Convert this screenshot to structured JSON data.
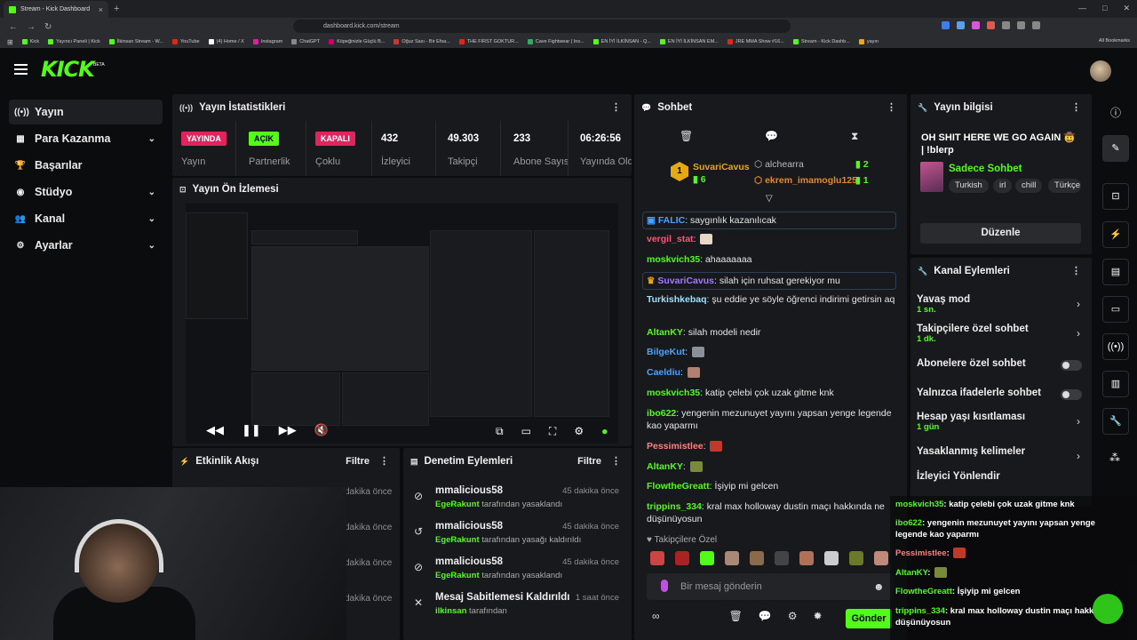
{
  "browser": {
    "tab_title": "Stream - Kick Dashboard",
    "url": "dashboard.kick.com/stream",
    "bookmarks": [
      "Kick",
      "Yayıncı Paneli | Kick",
      "İlkinsan Stream - W...",
      "YouTube",
      "(4) Home / X",
      "Instagram",
      "ChatGPT",
      "Köpeğinizle Güçlü B...",
      "Oğuz Sası - Bir Efsa...",
      "THE FIRST GOKTUR...",
      "Cave Fightwear | Ins...",
      "EN İYİ İLKİNSAN - Q...",
      "EN İYİ İLKİNSAN EM...",
      "JRE MMA Show #16...",
      "Stream - Kick Dashb...",
      "yayın"
    ],
    "all_bookmarks": "All Bookmarks"
  },
  "app": {
    "logo": "KICK",
    "beta": "BETA"
  },
  "sidebar": {
    "items": [
      {
        "label": "Yayın"
      },
      {
        "label": "Para Kazanma"
      },
      {
        "label": "Başarılar"
      },
      {
        "label": "Stüdyo"
      },
      {
        "label": "Kanal"
      },
      {
        "label": "Ayarlar"
      }
    ]
  },
  "stats": {
    "title": "Yayın İstatistikleri",
    "cells": [
      {
        "badge": "YAYINDA",
        "label": "Yayın"
      },
      {
        "badge": "AÇIK",
        "label": "Partnerlik"
      },
      {
        "badge": "KAPALI",
        "label": "Çoklu"
      },
      {
        "value": "432",
        "label": "İzleyici"
      },
      {
        "value": "49.303",
        "label": "Takipçi"
      },
      {
        "value": "233",
        "label": "Abone Sayısı"
      },
      {
        "value": "06:26:56",
        "label": "Yayında Olduğu"
      }
    ]
  },
  "preview": {
    "title": "Yayın Ön İzlemesi"
  },
  "activity": {
    "title": "Etkinlik Akışı",
    "filter": "Filtre",
    "lines": [
      "dakika önce",
      "dakika önce",
      "dakika önce",
      "dakika önce"
    ]
  },
  "moderation": {
    "title": "Denetim Eylemleri",
    "filter": "Filtre",
    "items": [
      {
        "name": "mmalicious58",
        "time": "45 dakika önce",
        "by": "EgeRakunt",
        "action": "tarafından yasaklandı"
      },
      {
        "name": "mmalicious58",
        "time": "45 dakika önce",
        "by": "EgeRakunt",
        "action": "tarafından yasağı kaldırıldı"
      },
      {
        "name": "mmalicious58",
        "time": "45 dakika önce",
        "by": "EgeRakunt",
        "action": "tarafından yasaklandı"
      },
      {
        "name": "Mesaj Sabitlemesi Kaldırıldı",
        "time": "1 saat önce",
        "by": "ilkinsan",
        "action": "tarafından"
      }
    ]
  },
  "chat": {
    "title": "Sohbet",
    "leaders": [
      {
        "rank": "1",
        "name": "SuvariCavus",
        "count": "6"
      },
      {
        "name": "alchearra",
        "count": "2"
      },
      {
        "name": "ekrem_imamoglu125",
        "count": "1"
      }
    ],
    "messages": [
      {
        "user": "FALIC",
        "text": "saygınlık kazanılıcak",
        "color": "#4aa3ff"
      },
      {
        "user": "vergil_stat",
        "text": "",
        "color": "#ff5577"
      },
      {
        "user": "moskvich35",
        "text": "ahaaaaaaa",
        "color": "#53fc18"
      },
      {
        "user": "SuvariCavus",
        "text": "silah için ruhsat gerekiyor mu",
        "color": "#a07cff"
      },
      {
        "user": "Turkishkebaq",
        "text": "şu eddie ye söyle öğrenci indirimi getirsin aq",
        "color": "#9fe0ff"
      },
      {
        "user": "AltanKY",
        "text": "silah modeli nedir",
        "color": "#53fc18"
      },
      {
        "user": "BilgeKut",
        "text": "",
        "color": "#4aa3ff"
      },
      {
        "user": "Caeldiu",
        "text": "",
        "color": "#4aa3ff"
      },
      {
        "user": "moskvich35",
        "text": "katip çelebi çok uzak gitme knk",
        "color": "#53fc18"
      },
      {
        "user": "ibo622",
        "text": "yengenin mezunuyet yayını yapsan yenge legende kao yaparmı",
        "color": "#53fc18"
      },
      {
        "user": "Pessimistlee",
        "text": "",
        "color": "#ff8080"
      },
      {
        "user": "AltanKY",
        "text": "",
        "color": "#53fc18"
      },
      {
        "user": "FlowtheGreatt",
        "text": "İşiyip mi gelcen",
        "color": "#53fc18"
      },
      {
        "user": "trippins_334",
        "text": "kral max holloway dustin maçı hakkında ne düşünüyosun",
        "color": "#53fc18"
      }
    ],
    "followers_label": "Takipçilere Özel",
    "input_placeholder": "Bir mesaj gönderin",
    "send": "Gönder"
  },
  "info": {
    "title": "Yayın bilgisi",
    "stream_title": "OH SHIT HERE WE GO AGAIN 🤠 | !blerp",
    "category": "Sadece Sohbet",
    "tags": [
      "Turkish",
      "irl",
      "chill",
      "Türkçe"
    ],
    "edit": "Düzenle"
  },
  "channel_actions": {
    "title": "Kanal Eylemleri",
    "items": [
      {
        "name": "Yavaş mod",
        "value": "1 sn.",
        "kind": "arrow"
      },
      {
        "name": "Takipçilere özel sohbet",
        "value": "1 dk.",
        "kind": "arrow"
      },
      {
        "name": "Abonelere özel sohbet",
        "value": "",
        "kind": "toggle"
      },
      {
        "name": "Yalnızca ifadelerle sohbet",
        "value": "",
        "kind": "toggle"
      },
      {
        "name": "Hesap yaşı kısıtlaması",
        "value": "1 gün",
        "kind": "arrow"
      },
      {
        "name": "Yasaklanmış kelimeler",
        "value": "",
        "kind": "arrow"
      },
      {
        "name": "İzleyici Yönlendir",
        "value": "",
        "kind": "none"
      }
    ]
  },
  "overlay_chat": [
    {
      "user": "moskvich35",
      "text": "katip çelebi çok uzak gitme knk"
    },
    {
      "user": "ibo622",
      "text": "yengenin mezunuyet yayını yapsan yenge legende kao yaparmı"
    },
    {
      "user": "Pessimistlee",
      "text": ""
    },
    {
      "user": "AltanKY",
      "text": ""
    },
    {
      "user": "FlowtheGreatt",
      "text": "İşiyip mi gelcen"
    },
    {
      "user": "trippins_334",
      "text": "kral max holloway dustin maçı hakkında ne düşünüyosun"
    }
  ],
  "colors": {
    "accent": "#53fc18",
    "live": "#e0245e",
    "panel": "#18191c"
  }
}
